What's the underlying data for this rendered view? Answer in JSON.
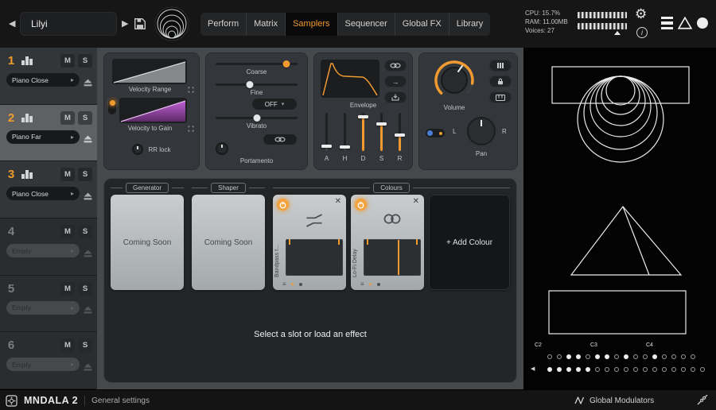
{
  "topbar": {
    "preset_name": "Lilyi",
    "tabs": [
      {
        "label": "Perform"
      },
      {
        "label": "Matrix"
      },
      {
        "label": "Samplers"
      },
      {
        "label": "Sequencer"
      },
      {
        "label": "Global FX"
      },
      {
        "label": "Library"
      }
    ],
    "active_tab": "Samplers",
    "cpu": "CPU: 15.7%",
    "ram": "RAM: 11.00MB",
    "voices": "Voices: 27"
  },
  "sidebar": {
    "mute": "M",
    "solo": "S",
    "slots": [
      {
        "number": "1",
        "name": "Piano Close",
        "state": "loaded"
      },
      {
        "number": "2",
        "name": "Piano Far",
        "state": "selected"
      },
      {
        "number": "3",
        "name": "Piano Close",
        "state": "loaded"
      },
      {
        "number": "4",
        "name": "Empty",
        "state": "empty"
      },
      {
        "number": "5",
        "name": "Empty",
        "state": "empty"
      },
      {
        "number": "6",
        "name": "Empty",
        "state": "empty"
      }
    ]
  },
  "velocity_panel": {
    "range_label": "Velocity Range",
    "gain_label": "Velocity to Gain",
    "rr_label": "RR lock"
  },
  "pitch_panel": {
    "coarse": "Coarse",
    "fine": "Fine",
    "mode": "OFF",
    "vibrato": "Vibrato",
    "portamento": "Portamento"
  },
  "envelope_panel": {
    "title": "Envelope",
    "stages": [
      {
        "label": "A",
        "value": 12,
        "orange": false
      },
      {
        "label": "H",
        "value": 10,
        "orange": false
      },
      {
        "label": "D",
        "value": 90,
        "orange": true
      },
      {
        "label": "S",
        "value": 70,
        "orange": true
      },
      {
        "label": "R",
        "value": 42,
        "orange": true
      }
    ]
  },
  "output_panel": {
    "volume": "Volume",
    "pan": "Pan",
    "left": "L",
    "right": "R"
  },
  "fx": {
    "generator_header": "Generator",
    "shaper_header": "Shaper",
    "colours_header": "Colours",
    "coming_soon": "Coming Soon",
    "colour_slots": [
      {
        "name": "Bandpass f..."
      },
      {
        "name": "Lo-Fi Delay"
      }
    ],
    "add_colour": "+ Add Colour",
    "hint": "Select a slot or load an effect"
  },
  "visualizer": {
    "octaves": [
      "C2",
      "C3",
      "C4"
    ],
    "dot_rows": [
      [
        0,
        0,
        1,
        1,
        0,
        1,
        1,
        0,
        1,
        0,
        0,
        1,
        0,
        0,
        0,
        0
      ],
      [
        1,
        1,
        1,
        1,
        1,
        0,
        0,
        0,
        0,
        0,
        0,
        0,
        0,
        0,
        0,
        0,
        0
      ]
    ]
  },
  "footer": {
    "brand": "MNDALA 2",
    "left_label": "General settings",
    "right_label": "Global Modulators"
  },
  "colors": {
    "accent": "#f09a30",
    "purple": "#8e3f9e",
    "blue": "#4a7fd6"
  }
}
